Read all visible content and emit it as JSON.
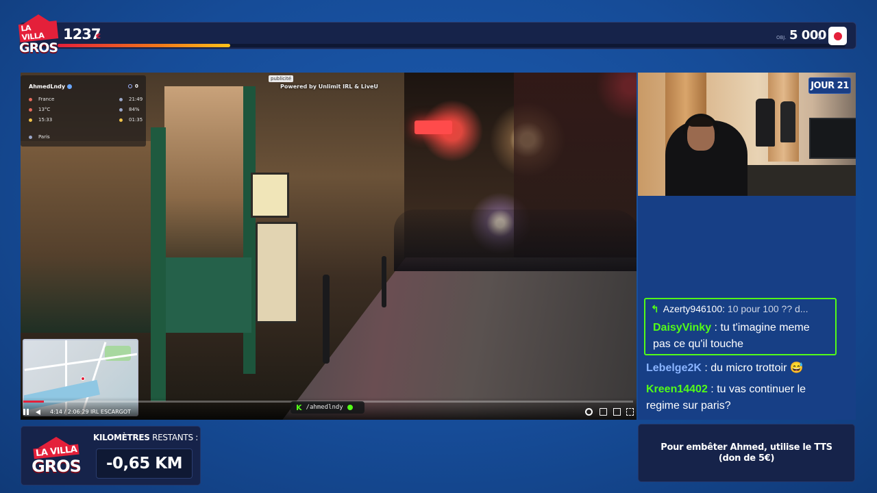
{
  "topbar": {
    "logo_line1": "LA VILLA",
    "logo_line2": "GROS",
    "count": "1237",
    "count_unit": "€",
    "progress": 0.219,
    "objective_label": "OBJ.",
    "objective_value": "5 000",
    "objective_unit": "€"
  },
  "stream": {
    "streamer_name": "AhmedLndy",
    "viewers": "0",
    "country": "France",
    "time": "21:49",
    "temperature": "13°C",
    "battery": "84%",
    "clock_left": "15:33",
    "clock_right": "01:35",
    "city": "Paris",
    "ad_tag": "publicité",
    "powered_by": "Powered by Unlimit IRL & LiveU",
    "time_position": "4:14 / 2:06:29",
    "title": "IRL ESCARGOT",
    "seek_fraction": 0.034,
    "handle": "/ahmedlndy"
  },
  "webcam": {
    "day_label": "JOUR 21"
  },
  "chat": {
    "reply": {
      "user": "Azerty946100:",
      "text": "10 pour 100 ?? d..."
    },
    "messages": [
      {
        "user": "DaisyVinky",
        "user_color": "#53fc18",
        "text": "tu t'imagine meme",
        "text2": "pas ce qu'il touche"
      },
      {
        "user": "Lebelge2K",
        "user_color": "#8ab4ff",
        "text": "du micro trottoir 😅"
      },
      {
        "user": "Kreen14402",
        "user_color": "#53fc18",
        "text": "tu vas continuer le",
        "text2": "regime sur paris?"
      }
    ]
  },
  "km_panel": {
    "logo_line1": "LA VILLA",
    "logo_line2": "GROS",
    "title_bold": "KILOMÈTRES",
    "title_rest": " RESTANTS :",
    "value": "-0,65 KM"
  },
  "tts": {
    "line1": "Pour embêter Ahmed, utilise le TTS",
    "line2": "(don de 5€)"
  }
}
